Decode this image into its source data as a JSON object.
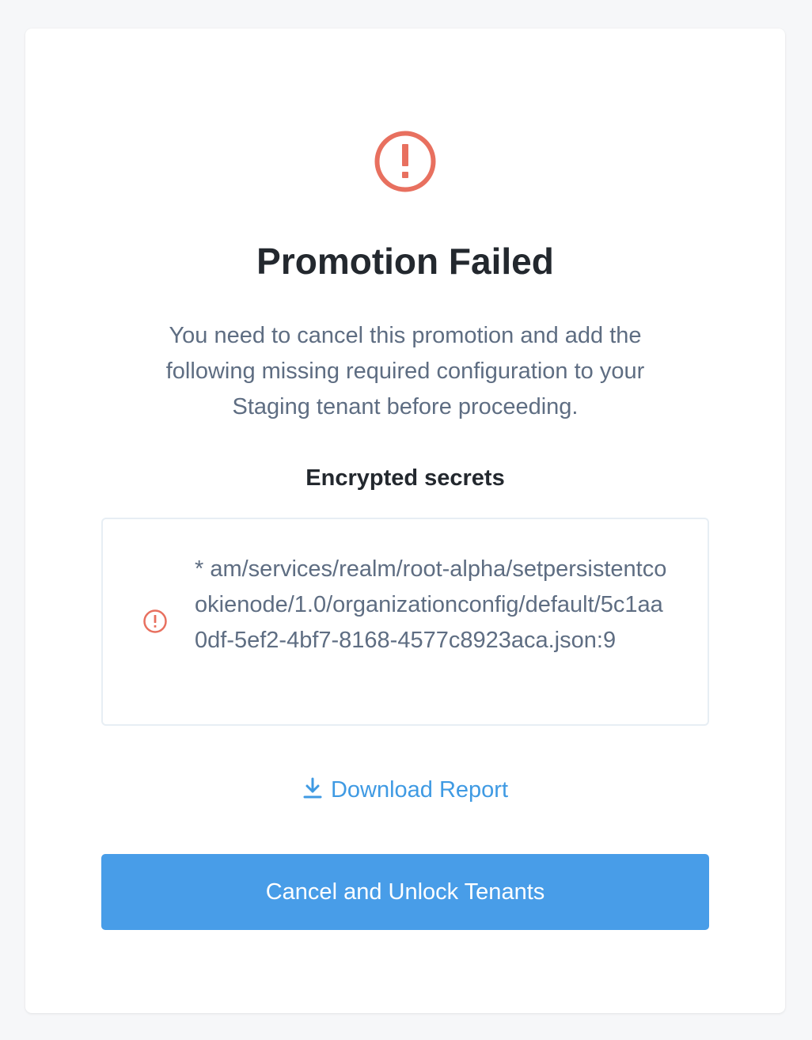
{
  "colors": {
    "error": "#e8705f",
    "link": "#3f9ae3",
    "primary_button": "#489de8",
    "title_text": "#23282e",
    "body_text": "#5e6d82"
  },
  "dialog": {
    "icon": "alert-circle-icon",
    "title": "Promotion Failed",
    "message": "You need to cancel this promotion and add the following missing required configuration to your Staging tenant before proceeding.",
    "section_label": "Encrypted secrets",
    "missing_items": [
      {
        "icon": "error-icon",
        "text": "* am/services/realm/root-alpha/setpersistentcookienode/1.0/organizationconfig/default/5c1aa0df-5ef2-4bf7-8168-4577c8923aca.json:9"
      }
    ],
    "download_link_label": "Download Report",
    "download_icon": "download-icon",
    "primary_button_label": "Cancel and Unlock Tenants"
  }
}
